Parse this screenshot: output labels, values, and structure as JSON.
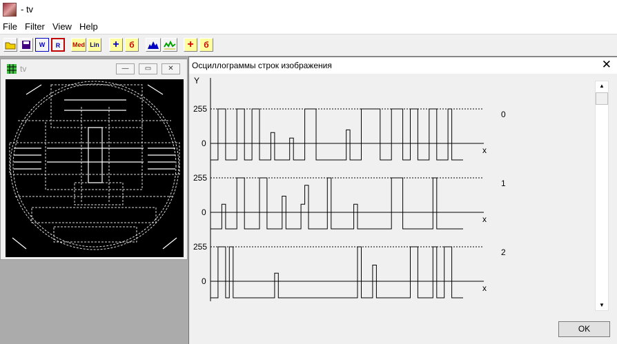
{
  "app": {
    "title": "- tv"
  },
  "menu": [
    "File",
    "Filter",
    "View",
    "Help"
  ],
  "toolbar": {
    "buttons": [
      {
        "name": "open-icon",
        "label": ""
      },
      {
        "name": "save-icon",
        "label": ""
      },
      {
        "name": "w-icon",
        "label": "W"
      },
      {
        "name": "r-icon",
        "label": "R"
      },
      {
        "name": "med-icon",
        "label": "Med"
      },
      {
        "name": "lin-icon",
        "label": "Lin"
      },
      {
        "name": "plus-blue-icon",
        "label": "+"
      },
      {
        "name": "sigma-icon",
        "label": "б"
      },
      {
        "name": "histogram-blue-icon",
        "label": ""
      },
      {
        "name": "histogram-green-icon",
        "label": ""
      },
      {
        "name": "plus-red-icon",
        "label": "+"
      },
      {
        "name": "sigma-red-icon",
        "label": "б"
      }
    ]
  },
  "child_window": {
    "title": "tv",
    "minimize": "—",
    "restore": "▭",
    "close": "✕"
  },
  "dialog": {
    "title": "Осциллограммы строк изображения",
    "close": "✕",
    "ok_label": "OK",
    "y_axis_label": "Y",
    "x_axis_label": "x",
    "level_high": "255",
    "level_zero": "0",
    "rows": [
      "0",
      "1",
      "2"
    ]
  },
  "chart_data": {
    "type": "line",
    "title": "Осциллограммы строк изображения",
    "ylabel": "Y",
    "xlabel": "x",
    "ylim": [
      0,
      255
    ],
    "series": [
      {
        "name": "0",
        "values": [
          0,
          0,
          255,
          255,
          0,
          0,
          0,
          255,
          255,
          0,
          0,
          255,
          255,
          0,
          0,
          0,
          80,
          0,
          0,
          0,
          0,
          40,
          0,
          0,
          0,
          255,
          255,
          255,
          0,
          0,
          0,
          0,
          0,
          0,
          0,
          0,
          100,
          0,
          0,
          0,
          255,
          255,
          255,
          255,
          255,
          0,
          0,
          0,
          255,
          255,
          255,
          0,
          0,
          255,
          255,
          0,
          0,
          0,
          255,
          255,
          0,
          0,
          0,
          255,
          0,
          0,
          0
        ]
      },
      {
        "name": "1",
        "values": [
          0,
          0,
          0,
          60,
          0,
          0,
          0,
          255,
          255,
          0,
          0,
          0,
          0,
          255,
          255,
          0,
          0,
          0,
          0,
          120,
          0,
          0,
          0,
          0,
          60,
          200,
          0,
          0,
          0,
          0,
          0,
          255,
          0,
          0,
          0,
          0,
          0,
          0,
          60,
          0,
          0,
          0,
          0,
          0,
          0,
          0,
          0,
          0,
          255,
          255,
          255,
          0,
          0,
          0,
          0,
          0,
          0,
          0,
          0,
          255,
          0,
          0,
          0,
          0,
          0,
          0,
          0
        ]
      },
      {
        "name": "2",
        "values": [
          0,
          0,
          255,
          255,
          0,
          255,
          0,
          0,
          0,
          0,
          0,
          0,
          0,
          0,
          0,
          0,
          0,
          60,
          0,
          0,
          0,
          0,
          0,
          0,
          0,
          0,
          0,
          0,
          0,
          0,
          0,
          0,
          0,
          0,
          0,
          0,
          0,
          0,
          0,
          255,
          0,
          0,
          0,
          120,
          0,
          0,
          0,
          0,
          0,
          0,
          0,
          0,
          0,
          255,
          255,
          0,
          0,
          0,
          0,
          255,
          0,
          0,
          255,
          255,
          0,
          0,
          0
        ]
      }
    ]
  }
}
